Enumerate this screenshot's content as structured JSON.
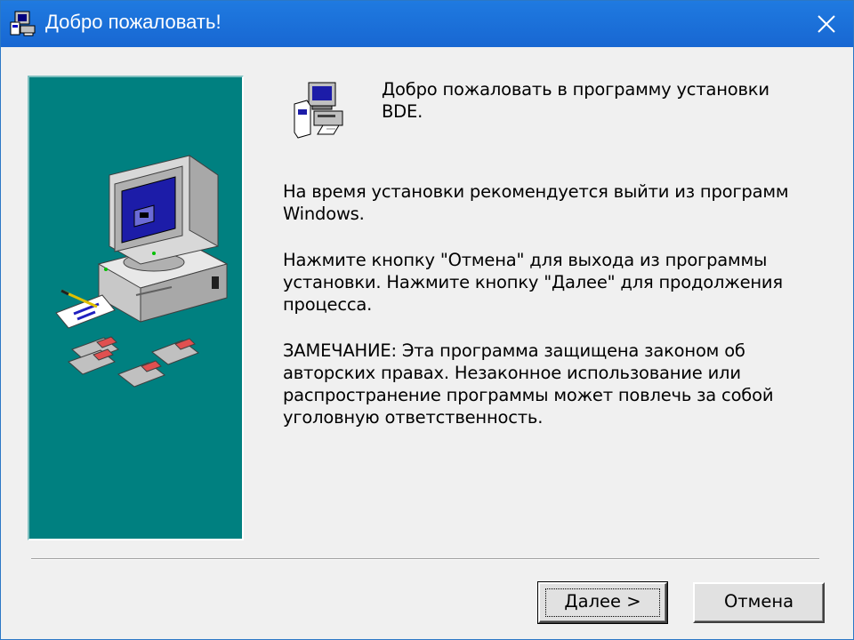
{
  "window": {
    "title": "Добро пожаловать!",
    "title_icon": "setup-app-icon",
    "close_icon": "close-icon"
  },
  "content": {
    "heading": "Добро пожаловать в программу установки BDE.",
    "paragraph1": "На время установки рекомендуется выйти из программ Windows.",
    "paragraph2": "Нажмите кнопку \"Отмена\" для выхода из программы установки.  Нажмите кнопку \"Далее\" для продолжения процесса.",
    "paragraph3": "ЗАМЕЧАНИЕ: Эта программа защищена законом об авторских правах. Незаконное использование или распространение программы может повлечь за собой уголовную ответственность."
  },
  "buttons": {
    "next_label": "Далее >",
    "cancel_label": "Отмена"
  },
  "colors": {
    "titlebar": "#1a73e8",
    "side_panel": "#008080",
    "window_bg": "#f0f0f0"
  }
}
